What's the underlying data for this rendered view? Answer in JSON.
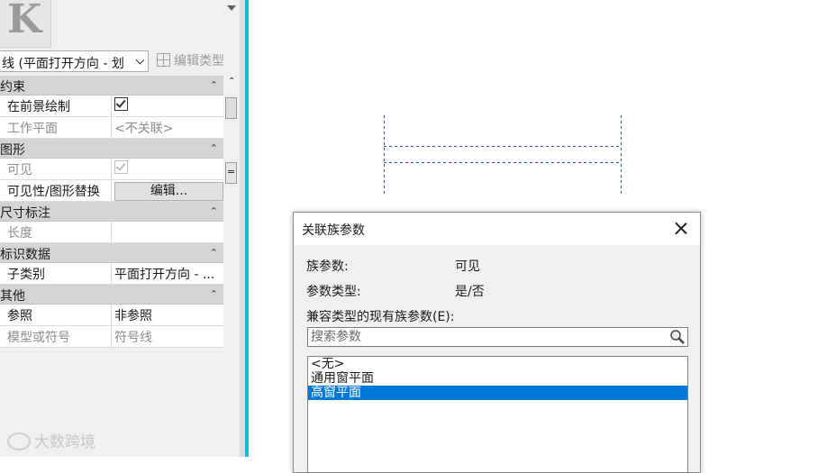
{
  "properties_palette": {
    "type_selector_value": "线 (平面打开方向 - 划",
    "edit_type_label": "编辑类型",
    "groups": [
      {
        "name": "约束",
        "rows": [
          {
            "key": "在前景绘制",
            "value_kind": "checkbox",
            "checked": true,
            "enabled": true
          },
          {
            "key": "工作平面",
            "value": "<不关联>",
            "dim": true
          }
        ]
      },
      {
        "name": "图形",
        "rows": [
          {
            "key": "可见",
            "value_kind": "checkbox",
            "checked": true,
            "enabled": false,
            "dim": true
          },
          {
            "key": "可见性/图形替换",
            "value_kind": "button",
            "button_label": "编辑..."
          }
        ]
      },
      {
        "name": "尺寸标注",
        "rows": [
          {
            "key": "长度",
            "value": "",
            "dim": true
          }
        ]
      },
      {
        "name": "标识数据",
        "rows": [
          {
            "key": "子类别",
            "value": "平面打开方向 - ..."
          }
        ]
      },
      {
        "name": "其他",
        "rows": [
          {
            "key": "参照",
            "value": "非参照"
          },
          {
            "key": "模型或符号",
            "value": "符号线",
            "dim": true
          }
        ]
      }
    ],
    "scroll_thumb_glyph": "="
  },
  "watermark": "大数跨境",
  "dialog": {
    "title": "关联族参数",
    "family_param_label": "族参数:",
    "family_param_value": "可见",
    "param_type_label": "参数类型:",
    "param_type_value": "是/否",
    "existing_params_label": "兼容类型的现有族参数(E):",
    "search_placeholder": "搜索参数",
    "list_items": [
      "<无>",
      "通用窗平面",
      "高窗平面"
    ],
    "selected_index": 2
  },
  "colors": {
    "selection": "#0078d7",
    "view_edge": "#1fb7d8",
    "dashed_lines": "#2b4fa8"
  }
}
